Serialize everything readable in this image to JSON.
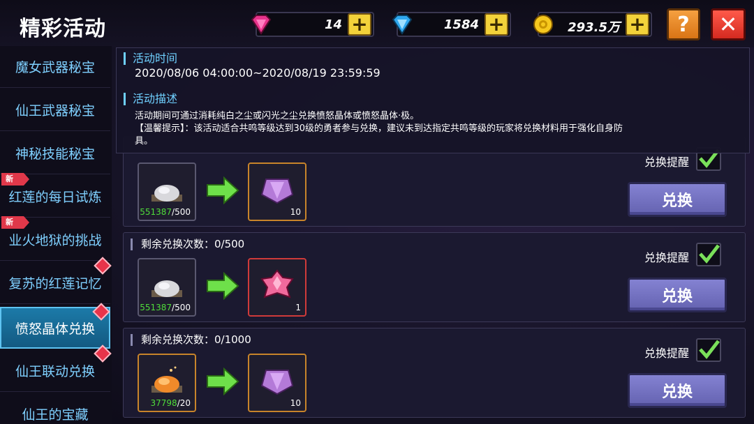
{
  "header": {
    "title": "精彩活动",
    "currencies": [
      {
        "icon": "pink-gem-icon",
        "value": "14"
      },
      {
        "icon": "blue-diamond-icon",
        "value": "1584"
      },
      {
        "icon": "gold-coin-icon",
        "value": "293.5万"
      }
    ],
    "help_label": "?",
    "close_label": "✕"
  },
  "sidebar": {
    "items": [
      {
        "label": "魔女武器秘宝"
      },
      {
        "label": "仙王武器秘宝"
      },
      {
        "label": "神秘技能秘宝"
      },
      {
        "label": "红莲的每日试炼",
        "badge": "新"
      },
      {
        "label": "业火地狱的挑战",
        "badge": "新"
      },
      {
        "label": "复苏的红莲记忆"
      },
      {
        "label": "愤怒晶体兑换",
        "active": true
      },
      {
        "label": "仙王联动兑换"
      },
      {
        "label": "仙王的宝藏"
      }
    ]
  },
  "info": {
    "time_heading": "活动时间",
    "time_value": "2020/08/06 04:00:00~2020/08/19 23:59:59",
    "desc_heading": "活动描述",
    "desc_line1": "活动期间可通过消耗纯白之尘或闪光之尘兑换愤怒晶体或愤怒晶体·极。",
    "desc_line2": "【温馨提示】：该活动适合共鸣等级达到30级的勇者参与兑换，建议未到达指定共鸣等级的玩家将兑换材料用于强化自身防",
    "desc_line3": "具。"
  },
  "rows": [
    {
      "remain_label": "",
      "input_item": "white-dust-icon",
      "input_have": "551387",
      "input_need": "/500",
      "output_item": "purple-crystal-icon",
      "output_count": "10",
      "remind_label": "兑换提醒",
      "button_label": "兑换"
    },
    {
      "remain_label": "剩余兑换次数：0/500",
      "input_item": "white-dust-icon",
      "input_have": "551387",
      "input_need": "/500",
      "output_item": "pink-crystal-icon",
      "output_count": "1",
      "remind_label": "兑换提醒",
      "button_label": "兑换"
    },
    {
      "remain_label": "剩余兑换次数：0/1000",
      "input_item": "orange-dust-icon",
      "input_have": "37798",
      "input_need": "/20",
      "output_item": "purple-crystal-icon",
      "output_count": "10",
      "remind_label": "兑换提醒",
      "button_label": "兑换"
    }
  ]
}
